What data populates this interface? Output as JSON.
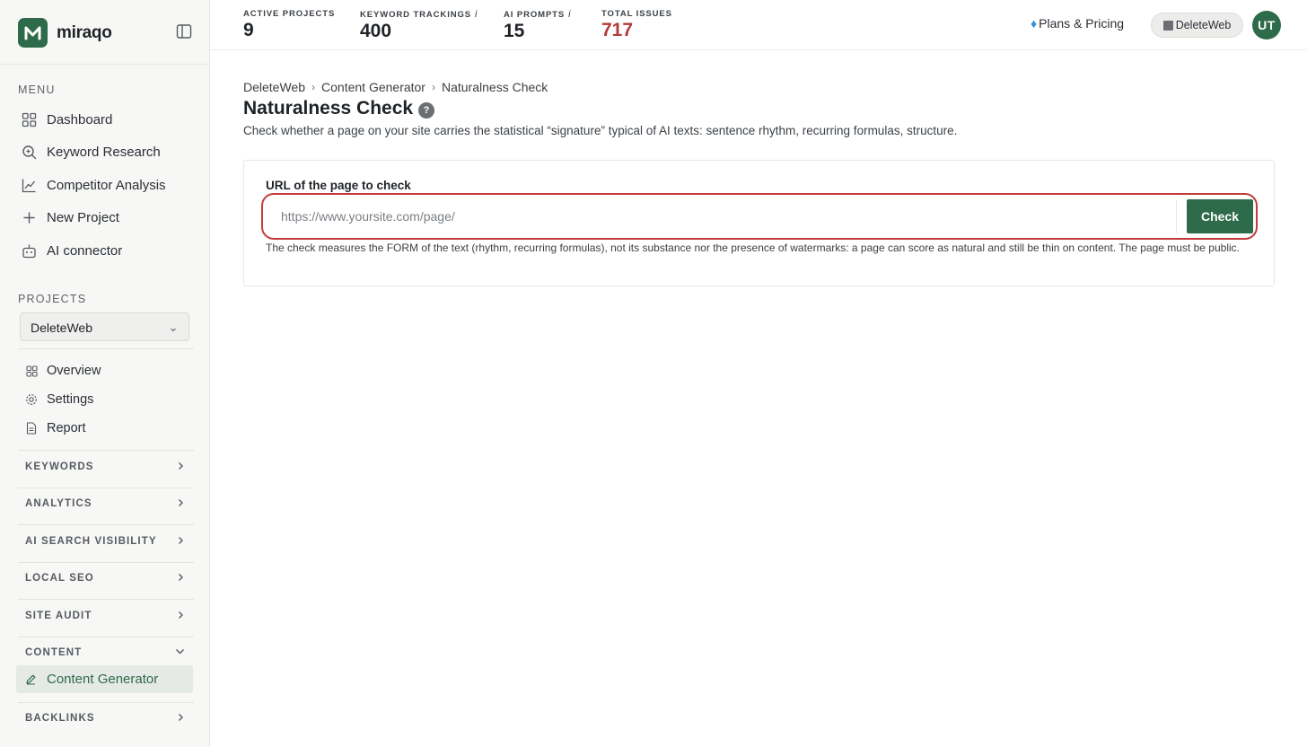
{
  "brand": {
    "name": "miraqo"
  },
  "sidebar": {
    "menu_label": "MENU",
    "menu_items": [
      {
        "label": "Dashboard",
        "icon": "grid-icon"
      },
      {
        "label": "Keyword Research",
        "icon": "search-icon"
      },
      {
        "label": "Competitor Analysis",
        "icon": "chart-line-icon"
      },
      {
        "label": "New Project",
        "icon": "plus-icon"
      },
      {
        "label": "AI connector",
        "icon": "robot-icon"
      }
    ],
    "projects_label": "PROJECTS",
    "project_select": {
      "value": "DeleteWeb"
    },
    "project_items": [
      {
        "label": "Overview",
        "icon": "grid-icon"
      },
      {
        "label": "Settings",
        "icon": "gear-icon"
      },
      {
        "label": "Report",
        "icon": "document-icon"
      }
    ],
    "groups": [
      {
        "label": "KEYWORDS",
        "expanded": false
      },
      {
        "label": "ANALYTICS",
        "expanded": false
      },
      {
        "label": "AI SEARCH VISIBILITY",
        "expanded": false
      },
      {
        "label": "LOCAL SEO",
        "expanded": false
      },
      {
        "label": "SITE AUDIT",
        "expanded": false
      },
      {
        "label": "CONTENT",
        "expanded": true
      },
      {
        "label": "BACKLINKS",
        "expanded": false
      }
    ],
    "active_item": {
      "label": "Content Generator",
      "icon": "pencil-icon"
    }
  },
  "topbar": {
    "stats": [
      {
        "label": "ACTIVE PROJECTS",
        "value": "9",
        "info": ""
      },
      {
        "label": "KEYWORD TRACKINGS",
        "value": "400",
        "info": "i"
      },
      {
        "label": "AI PROMPTS",
        "value": "15",
        "info": "i"
      },
      {
        "label": "TOTAL ISSUES",
        "value": "717",
        "info": ""
      }
    ],
    "pricing_label": "Plans & Pricing",
    "workspace_label": "DeleteWeb",
    "avatar_initials": "UT"
  },
  "main": {
    "breadcrumb": [
      "DeleteWeb",
      "Content Generator",
      "Naturalness Check"
    ],
    "title": "Naturalness Check",
    "help": "?",
    "description": "Check whether a page on your site carries the statistical “signature” typical of AI texts: sentence rhythm, recurring formulas, structure.",
    "form": {
      "field_label": "URL of the page to check",
      "url_value": "",
      "url_placeholder": "https://www.yoursite.com/page/",
      "button_label": "Check",
      "help_text": "The check measures the FORM of the text (rhythm, recurring formulas), not its substance nor the presence of watermarks: a page can score as natural and still be thin on content. The page must be public."
    }
  },
  "colors": {
    "brand_green": "#2e6b4a",
    "issues_red": "#b23b3b",
    "focus_ring": "#c23c3c"
  }
}
